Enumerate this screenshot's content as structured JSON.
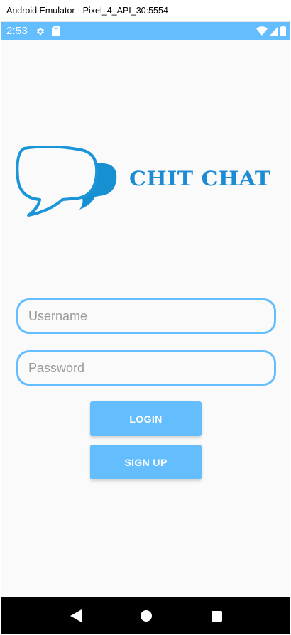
{
  "window": {
    "title": "Android Emulator - Pixel_4_API_30:5554"
  },
  "status_bar": {
    "time": "2:53",
    "left_icons": [
      "gear-icon",
      "sd-card-icon"
    ],
    "right_icons": [
      "wifi-icon",
      "cell-signal-icon",
      "battery-icon"
    ],
    "background_color": "#64bdfd"
  },
  "logo": {
    "text": "CHIT CHAT",
    "color": "#1c8bd3"
  },
  "login_form": {
    "username_placeholder": "Username",
    "password_placeholder": "Password",
    "login_label": "LOGIN",
    "signup_label": "SIGN UP",
    "accent_color": "#64bdfd"
  },
  "nav_bar": {
    "buttons": [
      "back-icon",
      "home-icon",
      "recents-icon"
    ]
  }
}
